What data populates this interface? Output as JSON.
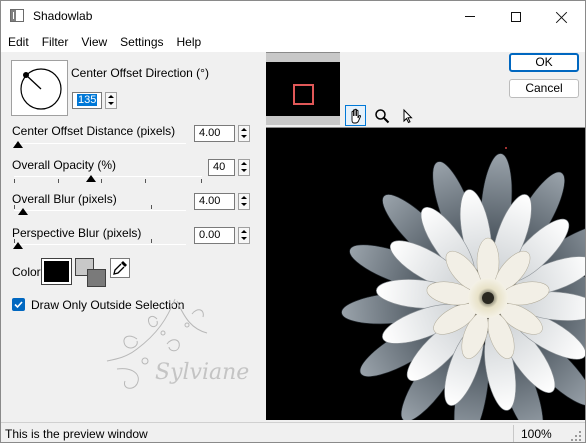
{
  "window": {
    "title": "Shadowlab"
  },
  "menu": {
    "items": [
      "Edit",
      "Filter",
      "View",
      "Settings",
      "Help"
    ]
  },
  "direction": {
    "label": "Center Offset Direction (°)",
    "value": "135"
  },
  "params": {
    "offset_distance": {
      "label": "Center Offset Distance (pixels)",
      "value": "4.00"
    },
    "opacity": {
      "label": "Overall Opacity (%)",
      "value": "40"
    },
    "blur": {
      "label": "Overall Blur (pixels)",
      "value": "4.00"
    },
    "perspective": {
      "label": "Perspective Blur (pixels)",
      "value": "0.00"
    }
  },
  "color": {
    "label": "Color",
    "swatch": "#000000"
  },
  "checkbox": {
    "label": "Draw Only Outside Selection",
    "checked": true
  },
  "buttons": {
    "ok": "OK",
    "cancel": "Cancel"
  },
  "watermark": {
    "text": "Sylviane"
  },
  "status": {
    "text": "This is the preview window",
    "zoom": "100%"
  },
  "colors": {
    "accent": "#0067c0",
    "preview_bg": "#000000",
    "thumb_marker": "#e05858"
  }
}
